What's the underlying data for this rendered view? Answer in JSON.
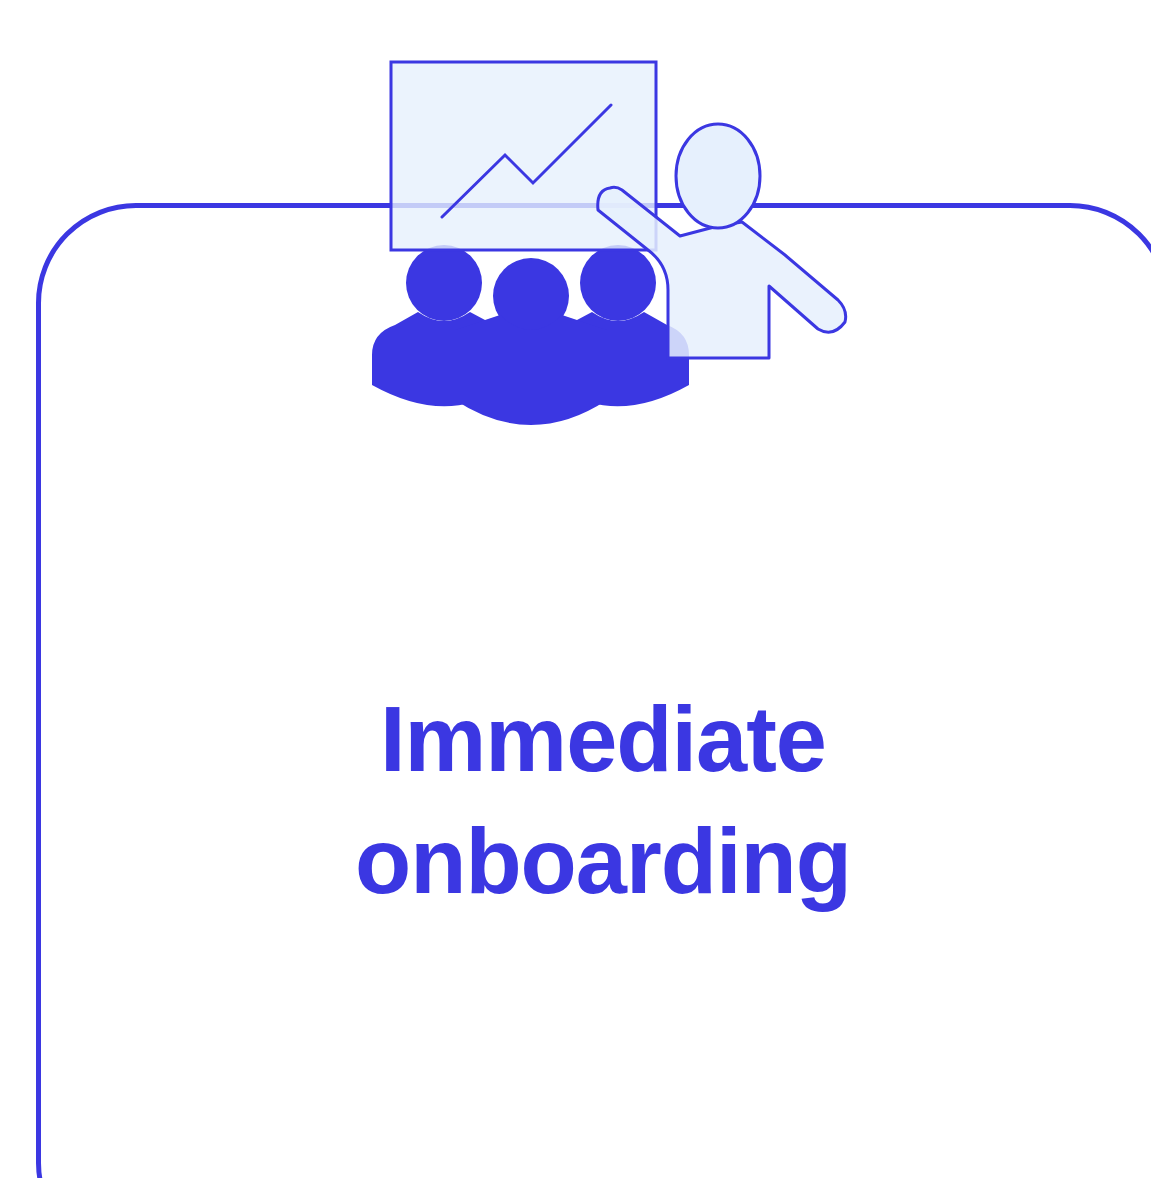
{
  "card": {
    "title": "Immediate onboarding"
  }
}
